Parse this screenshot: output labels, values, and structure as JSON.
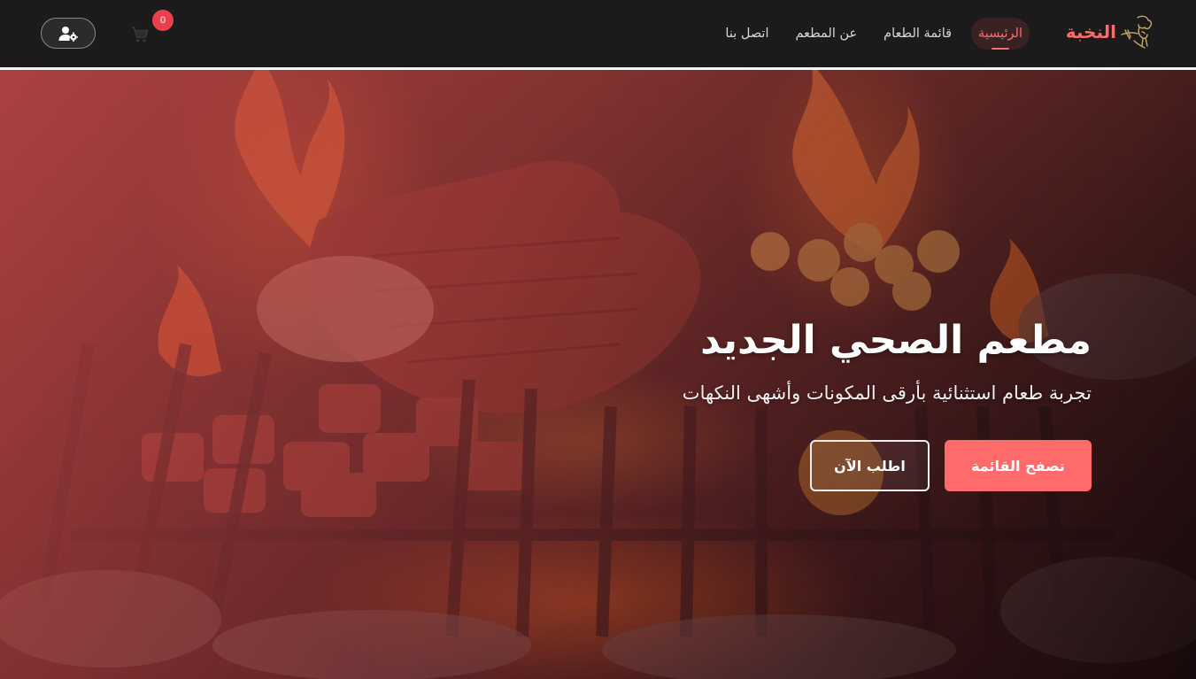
{
  "brand": {
    "name": "النخبة",
    "logo_icon": "chef-logo-icon",
    "color": "#ff6b6b"
  },
  "nav": {
    "links": [
      {
        "label": "الرئيسية",
        "active": true
      },
      {
        "label": "قائمة الطعام",
        "active": false
      },
      {
        "label": "عن المطعم",
        "active": false
      },
      {
        "label": "اتصل بنا",
        "active": false
      }
    ]
  },
  "cart": {
    "icon": "cart-icon",
    "count": "0"
  },
  "user": {
    "icon": "user-settings-icon"
  },
  "hero": {
    "title": "مطعم الصحي الجديد",
    "subtitle": "تجربة طعام استثنائية بأرقى المكونات وأشهى النكهات",
    "primary_button": "تصفح القائمة",
    "secondary_button": "اطلب الآن"
  },
  "colors": {
    "accent": "#ff6b6b",
    "navbar_bg": "#1b1b1b",
    "badge": "#e8414a"
  }
}
